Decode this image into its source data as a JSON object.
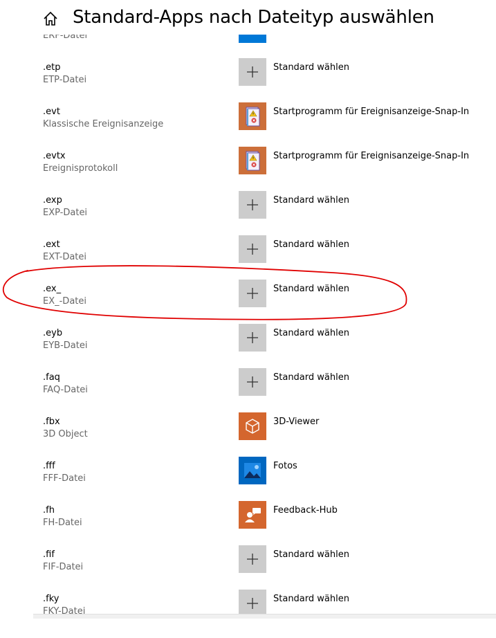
{
  "header": {
    "title": "Standard-Apps nach Dateityp auswählen"
  },
  "rows": [
    {
      "ext": "",
      "desc": "ERF-Datei",
      "app": "",
      "tile": "blue"
    },
    {
      "ext": ".etp",
      "desc": "ETP-Datei",
      "app": "Standard wählen",
      "tile": "plus"
    },
    {
      "ext": ".evt",
      "desc": "Klassische Ereignisanzeige",
      "app": "Startprogramm für Ereignisanzeige-Snap-In",
      "tile": "evt"
    },
    {
      "ext": ".evtx",
      "desc": "Ereignisprotokoll",
      "app": "Startprogramm für Ereignisanzeige-Snap-In",
      "tile": "evt"
    },
    {
      "ext": ".exp",
      "desc": "EXP-Datei",
      "app": "Standard wählen",
      "tile": "plus"
    },
    {
      "ext": ".ext",
      "desc": "EXT-Datei",
      "app": "Standard wählen",
      "tile": "plus"
    },
    {
      "ext": ".ex_",
      "desc": "EX_-Datei",
      "app": "Standard wählen",
      "tile": "plus"
    },
    {
      "ext": ".eyb",
      "desc": "EYB-Datei",
      "app": "Standard wählen",
      "tile": "plus"
    },
    {
      "ext": ".faq",
      "desc": "FAQ-Datei",
      "app": "Standard wählen",
      "tile": "plus"
    },
    {
      "ext": ".fbx",
      "desc": "3D Object",
      "app": "3D-Viewer",
      "tile": "viewer"
    },
    {
      "ext": ".fff",
      "desc": "FFF-Datei",
      "app": "Fotos",
      "tile": "fotos"
    },
    {
      "ext": ".fh",
      "desc": "FH-Datei",
      "app": "Feedback-Hub",
      "tile": "feedback"
    },
    {
      "ext": ".fif",
      "desc": "FIF-Datei",
      "app": "Standard wählen",
      "tile": "plus"
    },
    {
      "ext": ".fky",
      "desc": "FKY-Datei",
      "app": "Standard wählen",
      "tile": "plus"
    }
  ],
  "colors": {
    "plus_tile": "#cccccc",
    "evt_tile": "#cc6f3a",
    "viewer_tile": "#d4662e",
    "fotos_tile": "#0067c0",
    "annotation": "#e00000"
  }
}
